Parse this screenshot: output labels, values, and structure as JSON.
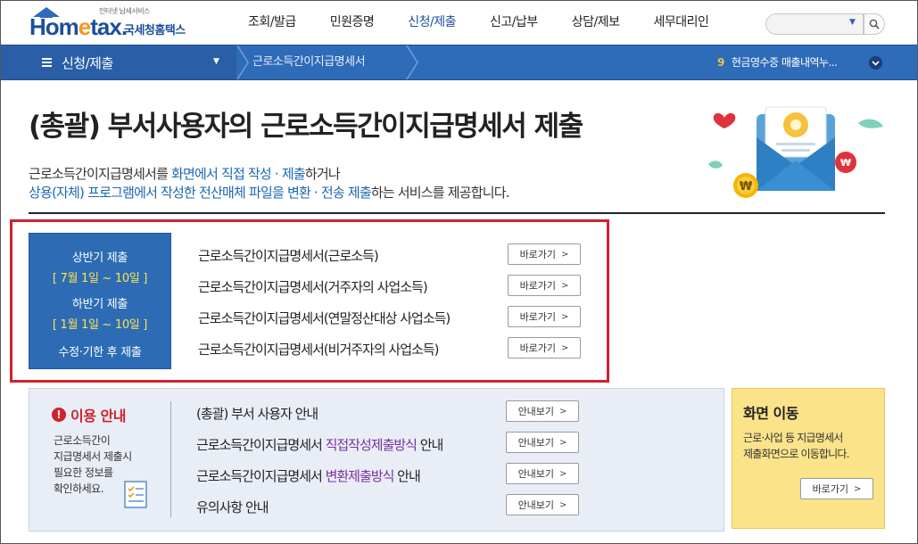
{
  "header": {
    "logo_small": "인터넷 납세서비스",
    "logo_main_a": "Hom",
    "logo_main_b": "e",
    "logo_main_c": "tax.",
    "logo_kor": "국세청홈택스",
    "menu": [
      "조회/발급",
      "민원증명",
      "신청/제출",
      "신고/납부",
      "상담/제보",
      "세무대리인"
    ],
    "active_menu_index": 2,
    "search": {
      "value": "",
      "placeholder": ""
    }
  },
  "location": {
    "menu_label": "신청/제출",
    "sub_label": "근로소득간이지급명세서",
    "notice_number": "9",
    "notice_text": "현금영수증 매출내역누..."
  },
  "page": {
    "title": "(총괄) 부서사용자의 근로소득간이지급명세서 제출",
    "desc_line1": {
      "a": "근로소득간이지급명세서를 ",
      "b": "화면에서 직접 작성 · 제출",
      "c": "하거나"
    },
    "desc_line2": {
      "a": "상용(자체) 프로그램에서 작성한 전산매체 파일을 변환 · 전송 제출",
      "b": "하는 서비스를 제공합니다."
    }
  },
  "period": {
    "first_half": "상반기 제출",
    "first_half_date": "[ 7월 1일 ~ 10일 ]",
    "second_half": "하반기 제출",
    "second_half_date": "[ 1월 1일 ~ 10일 ]",
    "late": "수정·기한 후 제출"
  },
  "submit_items": [
    {
      "label": "근로소득간이지급명세서(근로소득)",
      "button": "바로가기"
    },
    {
      "label": "근로소득간이지급명세서(거주자의 사업소득)",
      "button": "바로가기"
    },
    {
      "label": "근로소득간이지급명세서(연말정산대상 사업소득)",
      "button": "바로가기"
    },
    {
      "label": "근로소득간이지급명세서(비거주자의 사업소득)",
      "button": "바로가기"
    }
  ],
  "info": {
    "title": "이용 안내",
    "text": [
      "근로소득간이",
      "지급명세서 제출시",
      "필요한 정보를",
      "확인하세요."
    ]
  },
  "guides": [
    {
      "a": "(총괄) 부서 사용자 안내",
      "b": "",
      "c": "",
      "button": "안내보기"
    },
    {
      "a": "근로소득간이지급명세서 ",
      "b": "직접작성제출방식",
      "c": " 안내",
      "button": "안내보기"
    },
    {
      "a": "근로소득간이지급명세서 ",
      "b": "변환제출방식",
      "c": " 안내",
      "button": "안내보기"
    },
    {
      "a": "유의사항 안내",
      "b": "",
      "c": "",
      "button": "안내보기"
    }
  ],
  "move": {
    "title": "화면 이동",
    "text": [
      "근로·사업 등 지급명세서",
      "제출화면으로 이동합니다."
    ],
    "button": "바로가기"
  },
  "colors": {
    "brand_blue": "#1c4f9c",
    "location_bar": "#2e6bb8",
    "highlight_red": "#d1212b",
    "desc_blue": "#1a66b3",
    "guide_purple": "#7b2fa0",
    "period_date_yellow": "#fde24f"
  },
  "icons": [
    "house-icon",
    "search-icon",
    "hamburger-icon",
    "chevron-down-icon",
    "warning-icon",
    "checklist-icon",
    "envelope-illustration"
  ]
}
